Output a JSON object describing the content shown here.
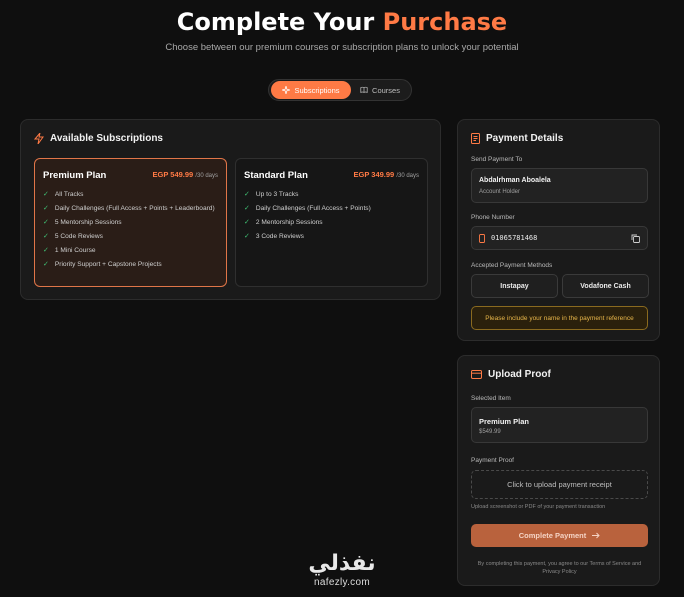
{
  "header": {
    "title_part1": "Complete Your ",
    "title_part2": "Purchase",
    "subtitle": "Choose between our premium courses or subscription plans to unlock your potential"
  },
  "tabs": [
    {
      "label": "Subscriptions",
      "icon": "sparkle-icon",
      "active": true
    },
    {
      "label": "Courses",
      "icon": "book-icon",
      "active": false
    }
  ],
  "subscriptions": {
    "title": "Available Subscriptions",
    "icon": "lightning-icon",
    "plans": [
      {
        "name": "Premium Plan",
        "price": "EGP 549.99",
        "period": "/30 days",
        "selected": true,
        "features": [
          "All Tracks",
          "Daily Challenges (Full Access + Points + Leaderboard)",
          "5 Mentorship Sessions",
          "5 Code Reviews",
          "1 Mini Course",
          "Priority Support + Capstone Projects"
        ]
      },
      {
        "name": "Standard Plan",
        "price": "EGP 349.99",
        "period": "/30 days",
        "selected": false,
        "features": [
          "Up to 3 Tracks",
          "Daily Challenges (Full Access + Points)",
          "2 Mentorship Sessions",
          "3 Code Reviews"
        ]
      }
    ]
  },
  "payment": {
    "title": "Payment Details",
    "icon": "receipt-icon",
    "send_to_label": "Send Payment To",
    "account_name": "Abdalrhman Aboalela",
    "account_role": "Account Holder",
    "phone_label": "Phone Number",
    "phone": "01065781468",
    "methods_label": "Accepted Payment Methods",
    "methods": [
      "Instapay",
      "Vodafone Cash"
    ],
    "notice": "Please include your name in the payment reference"
  },
  "upload": {
    "title": "Upload Proof",
    "icon": "card-icon",
    "selected_label": "Selected Item",
    "selected_name": "Premium Plan",
    "selected_price": "$549.99",
    "proof_label": "Payment Proof",
    "dropzone_text": "Click to upload payment receipt",
    "hint": "Upload screenshot or PDF of your payment transaction",
    "cta": "Complete Payment",
    "terms": "By completing this payment, you agree to our Terms of Service and Privacy Policy"
  },
  "watermark": {
    "arabic": "نفذلي",
    "latin": "nafezly.com"
  },
  "colors": {
    "accent": "#ff7a45",
    "background": "#0f0f0f",
    "panel": "#1a1a1a",
    "check": "#3fbf73",
    "notice": "#e8b64a"
  }
}
